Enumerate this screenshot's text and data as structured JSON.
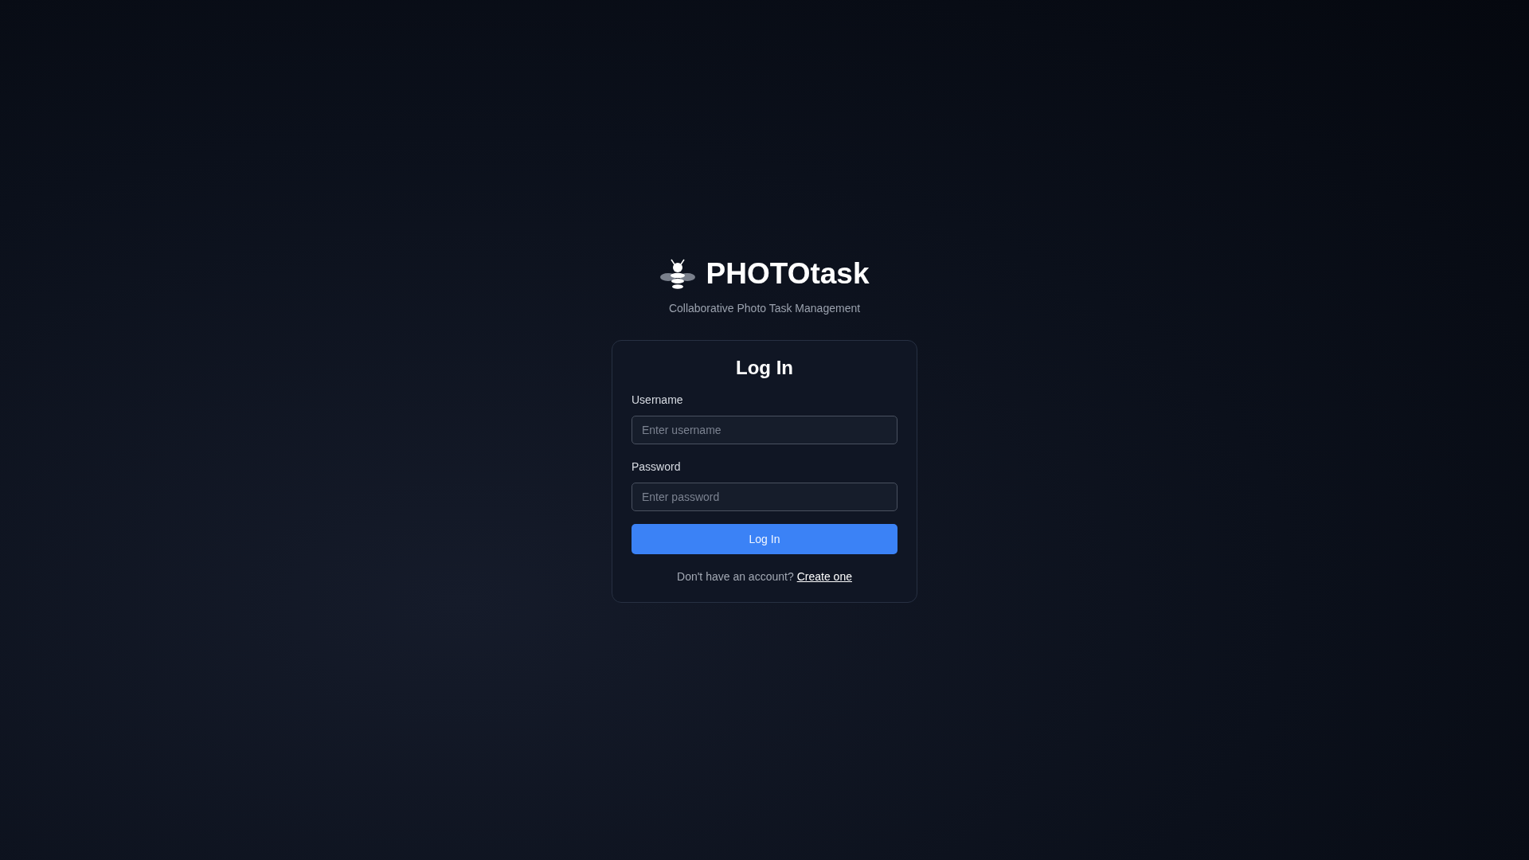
{
  "brand": {
    "name": "PHOTOtask",
    "tagline": "Collaborative Photo Task Management"
  },
  "card": {
    "title": "Log In",
    "fields": [
      {
        "label": "Username",
        "placeholder": "Enter username"
      },
      {
        "label": "Password",
        "placeholder": "Enter password"
      }
    ],
    "submit": "Log In",
    "footer": {
      "text": "Don't have an account?",
      "link": "Create one"
    }
  }
}
